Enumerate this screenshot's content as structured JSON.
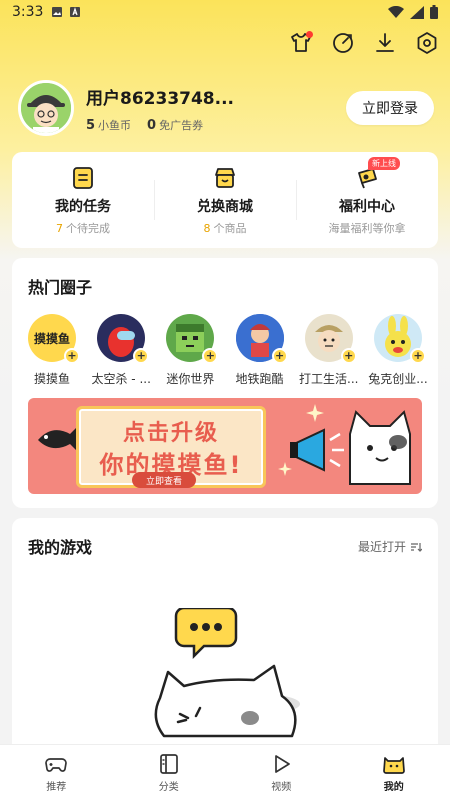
{
  "status_bar": {
    "time": "3:33"
  },
  "profile": {
    "username": "用户86233748...",
    "coins_value": "5",
    "coins_label": "小鱼币",
    "coupons_value": "0",
    "coupons_label": "免广告券",
    "login_label": "立即登录"
  },
  "quick_actions": [
    {
      "title": "我的任务",
      "count": "7",
      "subtitle": "个待完成",
      "icon": "task-list-icon"
    },
    {
      "title": "兑换商城",
      "count": "8",
      "subtitle": "个商品",
      "icon": "shop-icon"
    },
    {
      "title": "福利中心",
      "subtitle": "海量福利等你拿",
      "badge": "新上线",
      "icon": "gift-icon"
    }
  ],
  "hot_circles": {
    "title": "热门圈子",
    "items": [
      {
        "name": "摸摸鱼",
        "logo_text": "摸摸鱼"
      },
      {
        "name": "太空杀 - ..."
      },
      {
        "name": "迷你世界"
      },
      {
        "name": "地铁跑酷"
      },
      {
        "name": "打工生活..."
      },
      {
        "name": "兔克创业..."
      }
    ],
    "banner": {
      "line1": "点击升级",
      "line2": "你的摸摸鱼!",
      "button": "立即查看"
    }
  },
  "my_games": {
    "title": "我的游戏",
    "sort_label": "最近打开"
  },
  "tabs": [
    {
      "label": "推荐",
      "icon": "gamepad-icon"
    },
    {
      "label": "分类",
      "icon": "category-icon"
    },
    {
      "label": "视频",
      "icon": "play-icon"
    },
    {
      "label": "我的",
      "icon": "cat-face-icon",
      "active": true
    }
  ],
  "colors": {
    "accent": "#ffd84d",
    "brand_yellow": "#fbe35a",
    "highlight_number": "#e8a400",
    "badge_red": "#ff4d4f"
  }
}
